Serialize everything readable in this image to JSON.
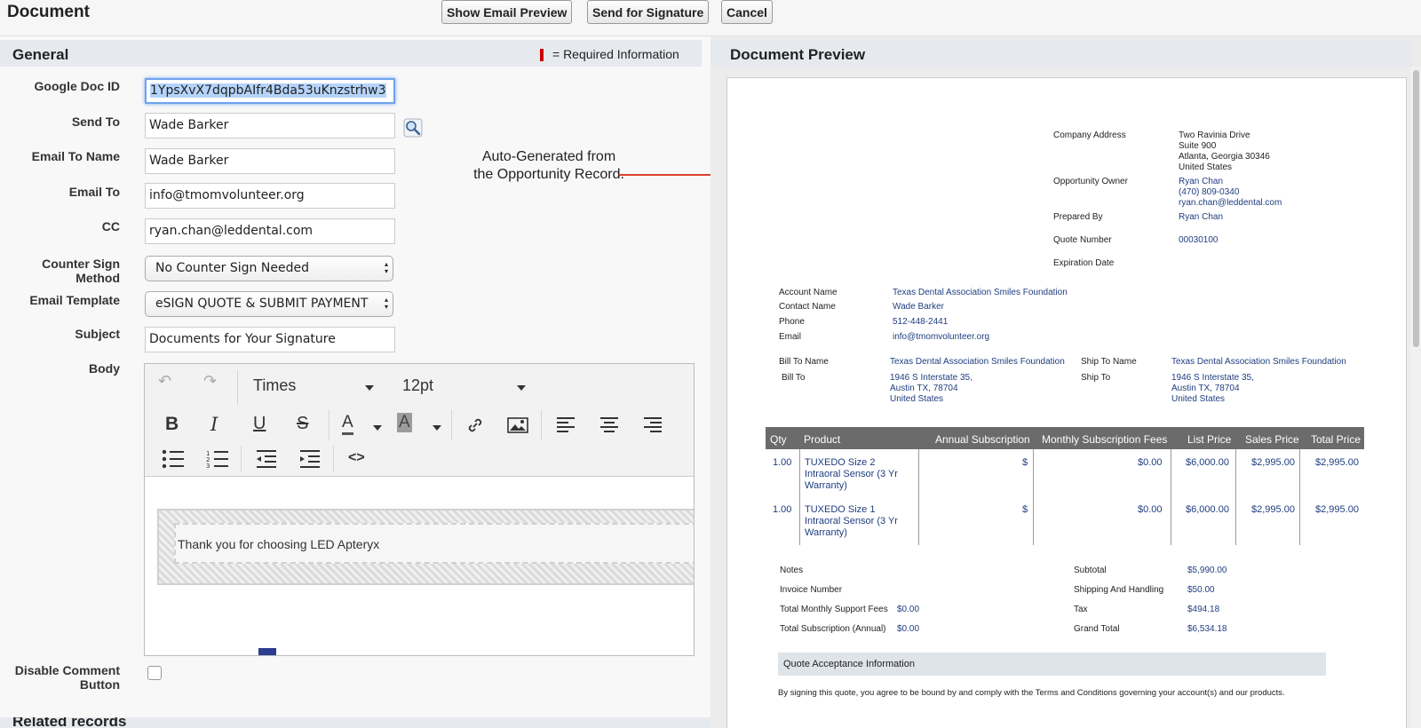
{
  "header": {
    "title": "Document",
    "buttons": {
      "email_preview": "Show Email Preview",
      "send_signature": "Send for Signature",
      "cancel": "Cancel"
    }
  },
  "general": {
    "title": "General",
    "required_legend": "= Required Information",
    "fields": {
      "google_doc_id": {
        "label": "Google Doc ID",
        "value": "1YpsXvX7dqpbAIfr4Bda53uKnzstrhw3"
      },
      "send_to": {
        "label": "Send To",
        "value": "Wade Barker"
      },
      "email_to_name": {
        "label": "Email To Name",
        "value": "Wade Barker"
      },
      "email_to": {
        "label": "Email To",
        "value": "info@tmomvolunteer.org"
      },
      "cc": {
        "label": "CC",
        "value": "ryan.chan@leddental.com"
      },
      "counter_sign": {
        "label": "Counter Sign Method",
        "value": "No Counter Sign Needed"
      },
      "email_template": {
        "label": "Email Template",
        "value": "eSIGN QUOTE & SUBMIT PAYMENT"
      },
      "subject": {
        "label": "Subject",
        "value": "Documents for Your Signature"
      },
      "body": {
        "label": "Body"
      },
      "disable_comment": {
        "label": "Disable Comment Button"
      }
    },
    "editor": {
      "font": "Times",
      "size": "12pt",
      "content": "Thank you for choosing LED Apteryx"
    }
  },
  "annotation": "Auto-Generated from the Opportunity Record.",
  "related_title": "Related records",
  "preview": {
    "title": "Document Preview",
    "company": {
      "address_label": "Company Address",
      "address": [
        "Two Ravinia Drive",
        "Suite 900",
        "Atlanta, Georgia 30346",
        "United States"
      ],
      "owner_label": "Opportunity Owner",
      "owner": [
        "Ryan Chan",
        "(470) 809-0340",
        "ryan.chan@leddental.com"
      ],
      "prepared_label": "Prepared By",
      "prepared": "Ryan Chan",
      "quote_label": "Quote Number",
      "quote": "00030100",
      "expiration_label": "Expiration Date"
    },
    "account": {
      "account_label": "Account Name",
      "account": "Texas Dental Association Smiles Foundation",
      "contact_label": "Contact Name",
      "contact": "Wade Barker",
      "phone_label": "Phone",
      "phone": "512-448-2441",
      "email_label": "Email",
      "email": "info@tmomvolunteer.org"
    },
    "billing": {
      "bill_name_label": "Bill To Name",
      "bill_name": "Texas Dental Association Smiles Foundation",
      "bill_label": "Bill To",
      "bill": [
        "1946 S Interstate 35,",
        "Austin TX, 78704",
        "United States"
      ],
      "ship_name_label": "Ship To Name",
      "ship_name": "Texas Dental Association Smiles Foundation",
      "ship_label": "Ship To",
      "ship": [
        "1946 S Interstate 35,",
        "Austin TX, 78704",
        "United States"
      ]
    },
    "table": {
      "headers": [
        "Qty",
        "Product",
        "Annual Subscription",
        "Monthly Subscription Fees",
        "List Price",
        "Sales Price",
        "Total Price"
      ],
      "rows": [
        {
          "qty": "1.00",
          "product": [
            "TUXEDO Size 2",
            "Intraoral Sensor (3 Yr",
            "Warranty)"
          ],
          "annual": "$",
          "monthly": "$0.00",
          "list": "$6,000.00",
          "sales": "$2,995.00",
          "total": "$2,995.00"
        },
        {
          "qty": "1.00",
          "product": [
            "TUXEDO Size 1",
            "Intraoral Sensor (3 Yr",
            "Warranty)"
          ],
          "annual": "$",
          "monthly": "$0.00",
          "list": "$6,000.00",
          "sales": "$2,995.00",
          "total": "$2,995.00"
        }
      ]
    },
    "summary": {
      "notes_label": "Notes",
      "invoice_label": "Invoice Number",
      "monthly_support_label": "Total Monthly Support Fees",
      "monthly_support": "$0.00",
      "subscription_label": "Total Subscription (Annual)",
      "subscription": "$0.00",
      "subtotal_label": "Subtotal",
      "subtotal": "$5,990.00",
      "shipping_label": "Shipping And Handling",
      "shipping": "$50.00",
      "tax_label": "Tax",
      "tax": "$494.18",
      "grand_label": "Grand Total",
      "grand": "$6,534.18"
    },
    "acceptance_title": "Quote Acceptance Information",
    "terms": "By signing this quote, you agree to be bound by and comply with the Terms and Conditions governing your account(s) and our products."
  }
}
